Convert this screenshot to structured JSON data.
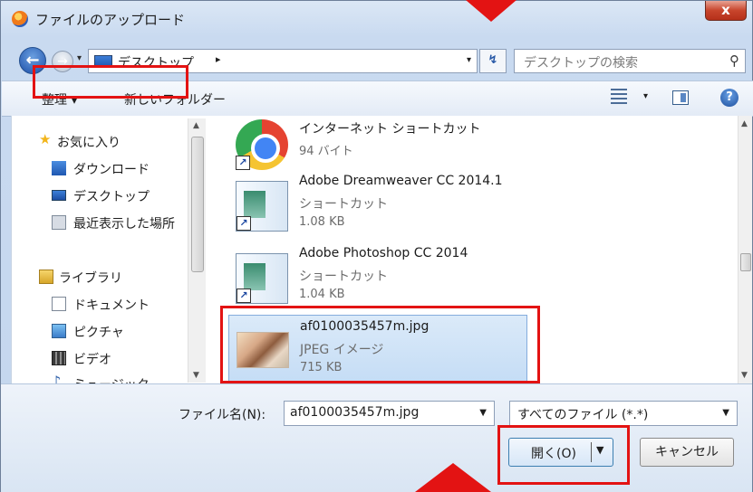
{
  "window": {
    "title": "ファイルのアップロード",
    "close_label": "x"
  },
  "address": {
    "location": "デスクトップ",
    "path_arrow": "▸",
    "dropdown": "▾",
    "refresh": "↯",
    "search_placeholder": "デスクトップの検索",
    "search_icon": "⚲"
  },
  "toolbar": {
    "organize": "整理 ▾",
    "new_folder": "新しいフォルダー",
    "view_dropdown": "▾",
    "help": "?"
  },
  "sidebar": {
    "items": [
      {
        "label": "お気に入り",
        "icon": "star-icon"
      },
      {
        "label": "ダウンロード",
        "icon": "downloads-icon"
      },
      {
        "label": "デスクトップ",
        "icon": "desktop-icon"
      },
      {
        "label": "最近表示した場所",
        "icon": "recent-places-icon"
      },
      {
        "label": "ライブラリ",
        "icon": "library-icon"
      },
      {
        "label": "ドキュメント",
        "icon": "documents-icon"
      },
      {
        "label": "ピクチャ",
        "icon": "pictures-icon"
      },
      {
        "label": "ビデオ",
        "icon": "videos-icon"
      },
      {
        "label": "ミュージック",
        "icon": "music-icon"
      }
    ]
  },
  "files": [
    {
      "name": "インターネット ショートカット",
      "type": "",
      "size": "94 バイト"
    },
    {
      "name": "Adobe Dreamweaver CC 2014.1",
      "type": "ショートカット",
      "size": "1.08 KB"
    },
    {
      "name": "Adobe Photoshop CC 2014",
      "type": "ショートカット",
      "size": "1.04 KB"
    },
    {
      "name": "af0100035457m.jpg",
      "type": "JPEG イメージ",
      "size": "715 KB"
    }
  ],
  "footer": {
    "filename_label": "ファイル名(N):",
    "filename_value": "af0100035457m.jpg",
    "filetype_value": "すべてのファイル (*.*)",
    "open_label": "開く(O)",
    "cancel_label": "キャンセル",
    "dropdown": "▼"
  },
  "colors": {
    "annotation_red": "#e31313",
    "selection_blue": "#c4dcf5"
  }
}
